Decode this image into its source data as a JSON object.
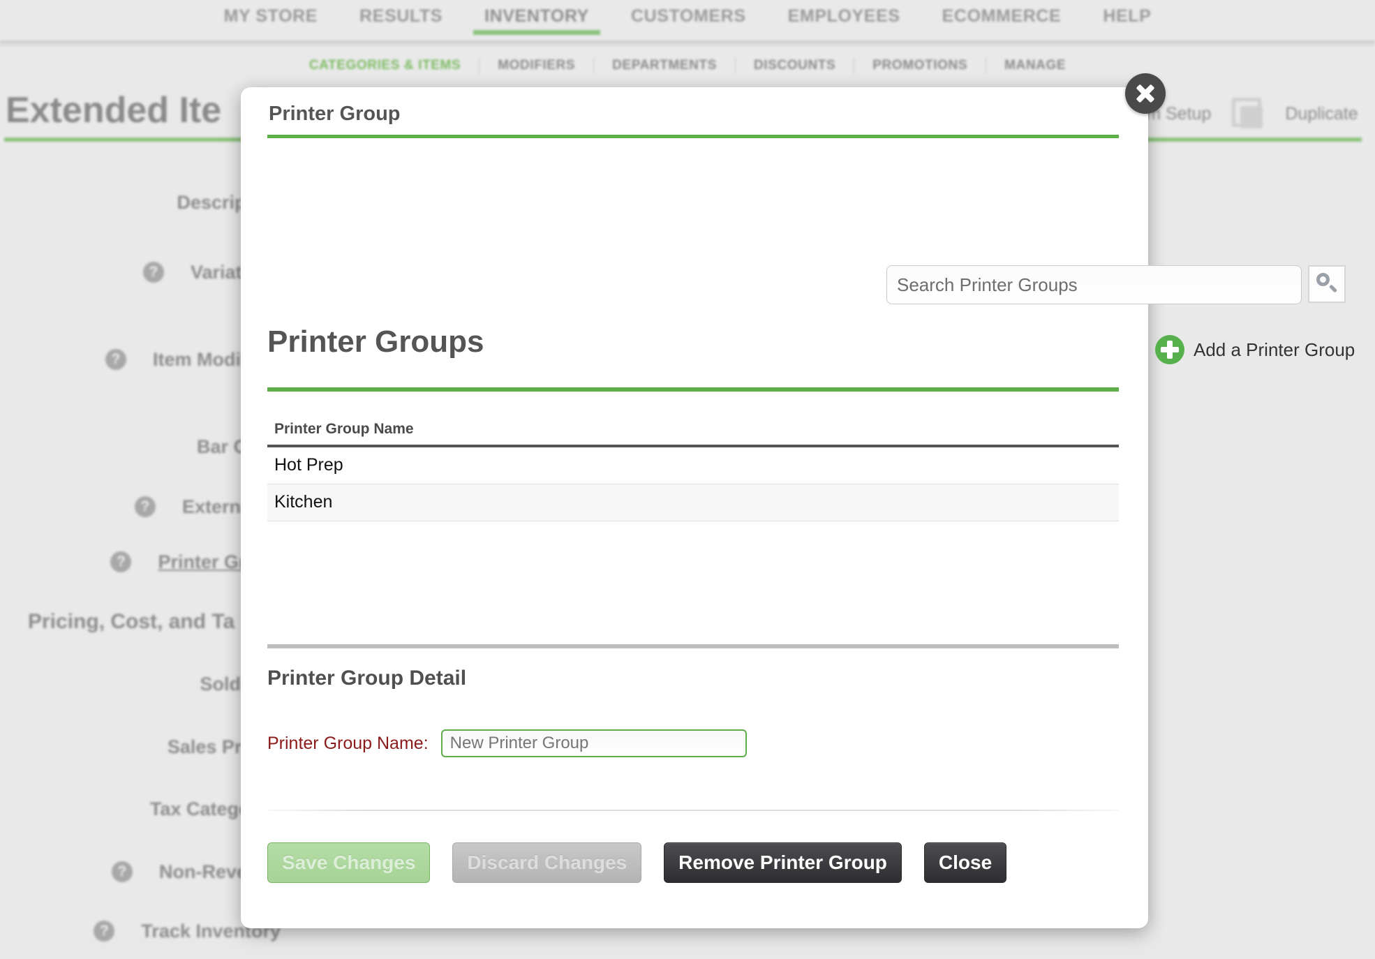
{
  "theme": {
    "accent_green": "#5faf48",
    "nav_green": "#8cc27e",
    "dark_button": "#3a3a3d",
    "required_label": "#8b1a1a"
  },
  "topnav": {
    "items": [
      {
        "label": "MY STORE",
        "active": false
      },
      {
        "label": "RESULTS",
        "active": false
      },
      {
        "label": "INVENTORY",
        "active": true
      },
      {
        "label": "CUSTOMERS",
        "active": false
      },
      {
        "label": "EMPLOYEES",
        "active": false
      },
      {
        "label": "ECOMMERCE",
        "active": false
      },
      {
        "label": "HELP",
        "active": false
      }
    ]
  },
  "subnav": {
    "items": [
      {
        "label": "CATEGORIES & ITEMS",
        "active": true
      },
      {
        "label": "MODIFIERS",
        "active": false
      },
      {
        "label": "DEPARTMENTS",
        "active": false
      },
      {
        "label": "DISCOUNTS",
        "active": false
      },
      {
        "label": "PROMOTIONS",
        "active": false
      },
      {
        "label": "MANAGE",
        "active": false
      }
    ]
  },
  "page": {
    "title": "Extended Ite",
    "basic_item_setup_label": "c Item Setup",
    "duplicate_label": "Duplicate",
    "form_labels": [
      {
        "label": "Description",
        "help": false,
        "link": false
      },
      {
        "label": "Variations",
        "help": true,
        "link": false
      },
      {
        "label": "Item Modifiers",
        "help": true,
        "link": false
      },
      {
        "label": "Bar Code",
        "help": false,
        "link": false
      },
      {
        "label": "External ID",
        "help": true,
        "link": false
      },
      {
        "label": "Printer Group",
        "help": true,
        "link": true
      }
    ],
    "section_heading": "Pricing, Cost, and Ta",
    "form_labels2": [
      {
        "label": "Sold by *",
        "help": false,
        "link": false
      },
      {
        "label": "Sales Price *",
        "help": false,
        "link": false
      },
      {
        "label": "Tax Category *",
        "help": false,
        "link": false
      },
      {
        "label": "Non-Revenue",
        "help": true,
        "link": false
      },
      {
        "label": "Track Inventory",
        "help": true,
        "link": false
      }
    ]
  },
  "modal": {
    "title": "Printer Group",
    "close_label": "Close dialog",
    "search": {
      "placeholder": "Search Printer Groups",
      "value": "",
      "button_icon": "search-icon"
    },
    "groups_heading": "Printer Groups",
    "add_group": {
      "label": "Add a Printer Group",
      "icon": "plus-circle-icon"
    },
    "table": {
      "columns": [
        "Printer Group Name"
      ],
      "rows": [
        {
          "name": "Hot Prep"
        },
        {
          "name": "Kitchen"
        }
      ]
    },
    "detail": {
      "heading": "Printer Group Detail",
      "name_label": "Printer Group Name:",
      "name_value": "",
      "name_placeholder": "New Printer Group"
    },
    "buttons": {
      "save": "Save Changes",
      "discard": "Discard Changes",
      "remove": "Remove Printer Group",
      "close": "Close"
    }
  }
}
